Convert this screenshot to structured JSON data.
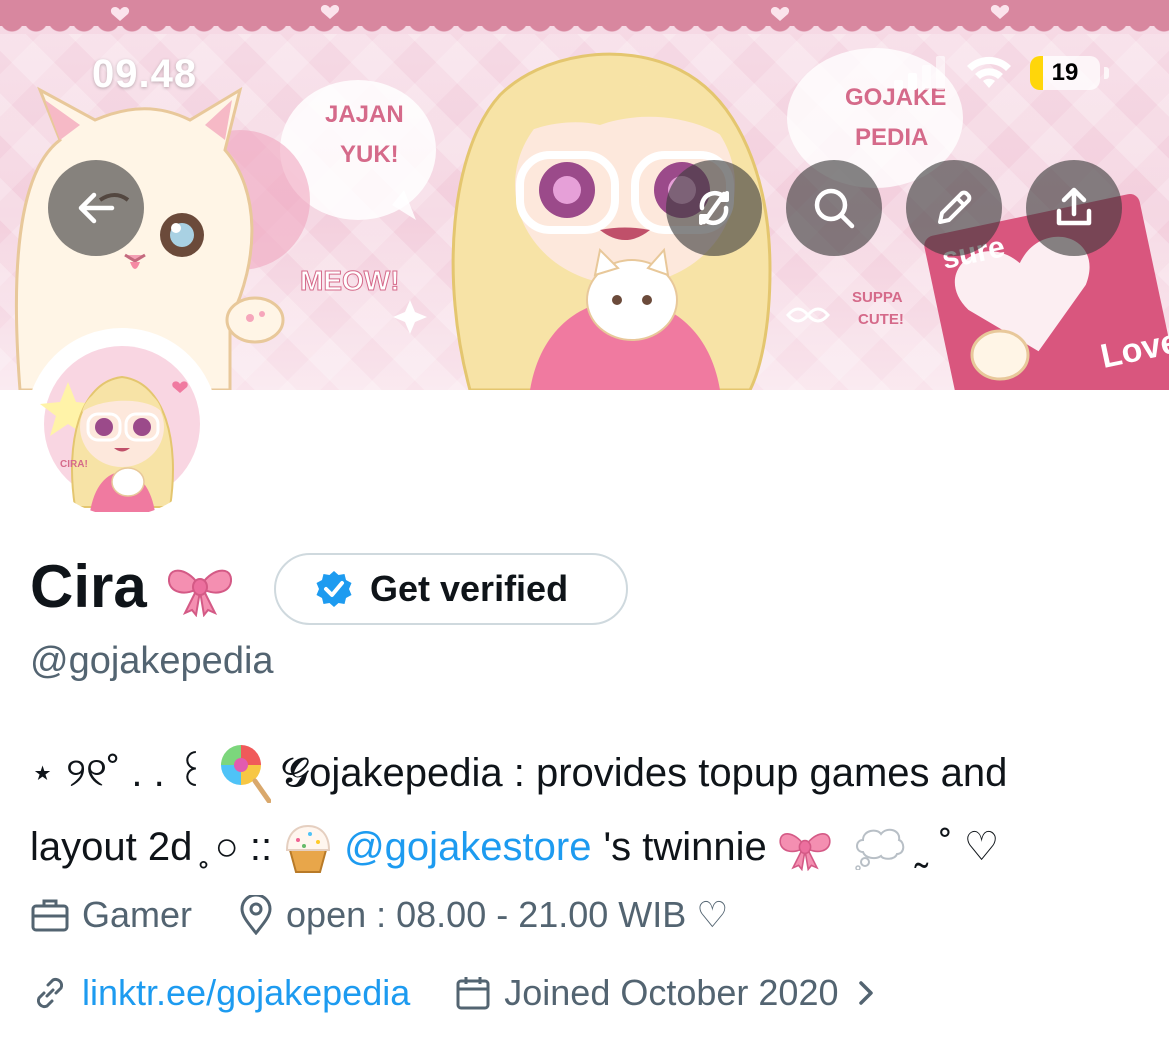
{
  "status_bar": {
    "time": "09.48",
    "battery_level": "19",
    "battery_fraction": 0.19
  },
  "header": {
    "back_icon": "arrow-left-icon",
    "actions": [
      {
        "icon": "sync-off-icon",
        "name": "hide-retweets-button"
      },
      {
        "icon": "search-icon",
        "name": "search-button"
      },
      {
        "icon": "pencil-icon",
        "name": "edit-button"
      },
      {
        "icon": "share-icon",
        "name": "share-button"
      }
    ]
  },
  "banner_text": {
    "jajan": "JAJAN",
    "yuk": "YUK!",
    "gojake": "GOJAKE",
    "pedia": "PEDIA",
    "meow": "MEOW!",
    "suppa": "SUPPA",
    "cute": "CUTE!",
    "sure": "sure",
    "love": "Love",
    "cira": "CIRA!"
  },
  "profile": {
    "display_name": "Cira",
    "name_emoji": "ribbon-emoji",
    "verify_button_label": "Get verified",
    "handle": "@gojakepedia"
  },
  "bio": {
    "line1_prefix": "⋆ ୨୧˚ . . ꒰",
    "line1_text": "𝓖ojakepedia : provides topup games and",
    "line2_start": "layout 2d ̥ ○ ::",
    "line2_mention": "@gojakestore",
    "line2_end": "'s twinnie",
    "line2_suffix": "˷ ˚ ♡"
  },
  "meta": {
    "category": "Gamer",
    "location": "open : 08.00 - 21.00 WIB ♡",
    "website": "linktr.ee/gojakepedia",
    "joined": "Joined October 2020"
  },
  "colors": {
    "link": "#1d9bf0",
    "muted": "#536471",
    "text": "#0f1419",
    "verified": "#1d9bf0"
  }
}
